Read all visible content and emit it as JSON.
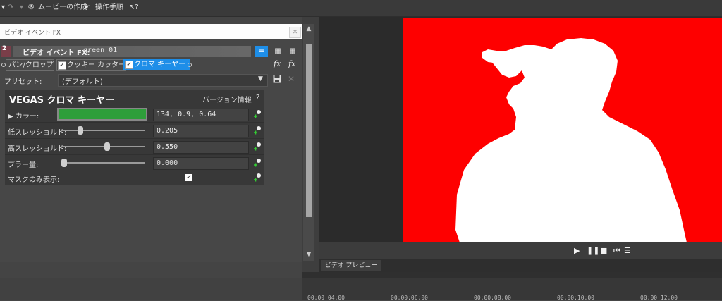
{
  "toolbar": {
    "create_movie": "ムービーの作成",
    "tutorial": "操作手順"
  },
  "fx_window": {
    "title": "ビデオ イベント FX",
    "chain": {
      "number": "2",
      "label": "ビデオ イベント FX:",
      "event_name": "green_01"
    },
    "plugins": [
      {
        "label": "パン/クロップ"
      },
      {
        "label": "クッキー カッター",
        "checked": true
      },
      {
        "label": "クロマ キーヤー",
        "checked": true,
        "selected": true
      }
    ],
    "preset": {
      "label": "プリセット:",
      "value": "(デフォルト)"
    }
  },
  "plugin_panel": {
    "title": "VEGAS クロマ キーヤー",
    "about": "バージョン情報",
    "help": "?",
    "params": {
      "color": {
        "label": "カラー:",
        "value": "134, 0.9, 0.64",
        "swatch": "#2e9e3a"
      },
      "low_threshold": {
        "label": "低スレッショルド:",
        "value": "0.205",
        "level": 0.205
      },
      "high_threshold": {
        "label": "高スレッショルド:",
        "value": "0.550",
        "level": 0.55
      },
      "blur": {
        "label": "ブラー量:",
        "value": "0.000",
        "level": 0.0
      },
      "mask_only": {
        "label": "マスクのみ表示:",
        "checked": true
      }
    }
  },
  "preview": {
    "background_color": "#fe0000",
    "tab_label": "ビデオ プレビュー"
  },
  "timeline": {
    "ticks": [
      "00:00:04:00",
      "00:00:06:00",
      "00:00:08:00",
      "00:00:10:00",
      "00:00:12:00"
    ]
  }
}
